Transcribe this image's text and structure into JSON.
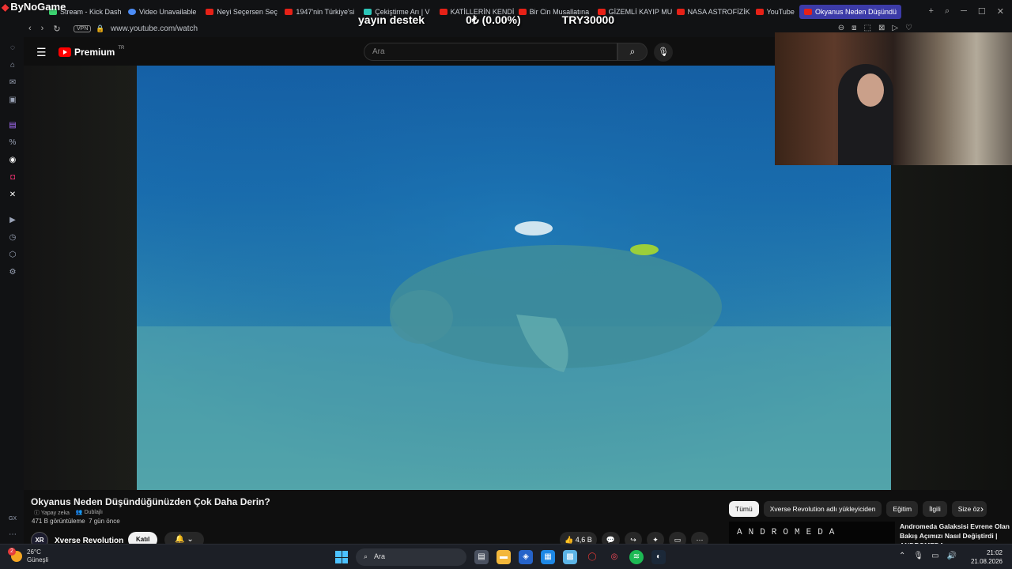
{
  "browser": {
    "brand": "ByNoGame",
    "tabs": [
      {
        "label": "Stream - Kick Dash",
        "fav": "green"
      },
      {
        "label": "Video Unavailable",
        "fav": "blue"
      },
      {
        "label": "Neyi Seçersen Seç",
        "fav": "red"
      },
      {
        "label": "1947'nin Türkiye'si",
        "fav": "red"
      },
      {
        "label": "Çekiştirme Arı | V",
        "fav": "teal"
      },
      {
        "label": "KATİLLERİN KENDİ",
        "fav": "red"
      },
      {
        "label": "Bir Cin Musallatına",
        "fav": "red"
      },
      {
        "label": "GİZEMLİ KAYIP MU",
        "fav": "red"
      },
      {
        "label": "NASA ASTROFİZİK",
        "fav": "red"
      },
      {
        "label": "YouTube",
        "fav": "red"
      },
      {
        "label": "Okyanus Neden Düşündü",
        "fav": "red",
        "active": true
      }
    ],
    "vpn_label": "VPN",
    "url": "www.youtube.com/watch"
  },
  "stream_overlay": {
    "left": "yayın destek",
    "center": "0₺ (0.00%)",
    "right": "TRY30000"
  },
  "youtube": {
    "logo_text": "Premium",
    "logo_sup": "TR",
    "search_placeholder": "Ara"
  },
  "video": {
    "title": "Okyanus Neden Düşündüğünüzden Çok Daha Derin?",
    "tag_ai": "Yapay zeka",
    "tag_dub": "Dublajlı",
    "views": "471 B görüntüleme",
    "age": "7 gün önce",
    "channel_initials": "XR",
    "channel_name": "Xverse Revolution",
    "join_label": "Katıl",
    "likes": "4,6 B"
  },
  "chips": [
    "Tümü",
    "Xverse Revolution adlı yükleyiciden",
    "Eğitim",
    "İlgili",
    "Size öz"
  ],
  "recommendation": {
    "thumb_text": "ANDROMEDA",
    "title": "Andromeda Galaksisi Evrene Olan Bakış Açımızı Nasıl Değiştirdi | ANDROMEDA"
  },
  "taskbar": {
    "temp": "26°C",
    "weather": "Güneşli",
    "weather_badge": "2",
    "search": "Ara",
    "time": "21:02",
    "date": "21.08.2026"
  }
}
